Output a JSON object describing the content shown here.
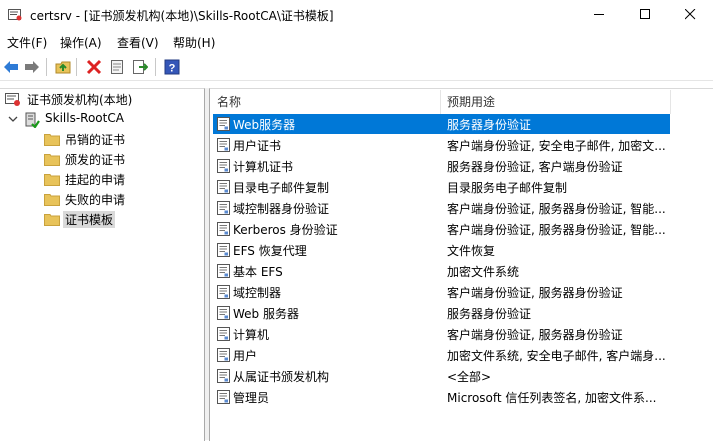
{
  "window": {
    "title": "certsrv - [证书颁发机构(本地)\\Skills-RootCA\\证书模板]",
    "icon": "certsrv-app-icon"
  },
  "menu": [
    "文件(F)",
    "操作(A)",
    "查看(V)",
    "帮助(H)"
  ],
  "toolbar": [
    "back-arrow-icon",
    "forward-arrow-icon",
    "up-folder-icon",
    "delete-icon",
    "properties-icon",
    "export-icon",
    "help-icon"
  ],
  "tree": {
    "root": "证书颁发机构(本地)",
    "ca": "Skills-RootCA",
    "folders": [
      "吊销的证书",
      "颁发的证书",
      "挂起的申请",
      "失败的申请",
      "证书模板"
    ],
    "selected_folder": "证书模板"
  },
  "list": {
    "columns": [
      "名称",
      "预期用途"
    ],
    "selected_row": 0,
    "rows": [
      {
        "name": "Web服务器",
        "purpose": "服务器身份验证"
      },
      {
        "name": "用户证书",
        "purpose": "客户端身份验证, 安全电子邮件, 加密文..."
      },
      {
        "name": "计算机证书",
        "purpose": "服务器身份验证, 客户端身份验证"
      },
      {
        "name": "目录电子邮件复制",
        "purpose": "目录服务电子邮件复制"
      },
      {
        "name": "域控制器身份验证",
        "purpose": "客户端身份验证, 服务器身份验证, 智能..."
      },
      {
        "name": "Kerberos 身份验证",
        "purpose": "客户端身份验证, 服务器身份验证, 智能..."
      },
      {
        "name": "EFS 恢复代理",
        "purpose": "文件恢复"
      },
      {
        "name": "基本 EFS",
        "purpose": "加密文件系统"
      },
      {
        "name": "域控制器",
        "purpose": "客户端身份验证, 服务器身份验证"
      },
      {
        "name": "Web 服务器",
        "purpose": "服务器身份验证"
      },
      {
        "name": "计算机",
        "purpose": "客户端身份验证, 服务器身份验证"
      },
      {
        "name": "用户",
        "purpose": "加密文件系统, 安全电子邮件, 客户端身..."
      },
      {
        "name": "从属证书颁发机构",
        "purpose": "<全部>"
      },
      {
        "name": "管理员",
        "purpose": "Microsoft 信任列表签名, 加密文件系..."
      }
    ]
  },
  "colors": {
    "selection": "#0078d7",
    "tree_selection": "#d9d9d9",
    "folder": "#e8c35a"
  }
}
